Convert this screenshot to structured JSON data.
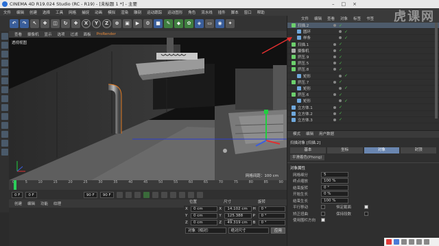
{
  "window": {
    "title": "CINEMA 4D R19.024 Studio (RC - R19) - [未标题 1 *] - 主要"
  },
  "watermark": "虎课网",
  "menubar": {
    "items": [
      "文件",
      "编辑",
      "创建",
      "选择",
      "工具",
      "网格",
      "捕捉",
      "动画",
      "模拟",
      "渲染",
      "雕刻",
      "运动跟踪",
      "运动图形",
      "角色",
      "流水线",
      "插件",
      "脚本",
      "窗口",
      "帮助"
    ]
  },
  "toolbar": {
    "axis_x": "X",
    "axis_y": "Y",
    "axis_z": "Z"
  },
  "viewport": {
    "menu": [
      "查看",
      "摄像机",
      "显示",
      "选项",
      "过滤",
      "面板"
    ],
    "prorender": "ProRender",
    "label": "透视视图",
    "grid_spacing": "网格间距：100 cm"
  },
  "timeline": {
    "ticks": [
      "0",
      "5",
      "10",
      "15",
      "20",
      "25",
      "30",
      "35",
      "40",
      "45",
      "50",
      "55",
      "60",
      "65",
      "70",
      "75",
      "80",
      "85",
      "90"
    ],
    "current_frame_label": "0 F"
  },
  "transport": {
    "start": "0 F",
    "current": "0 F",
    "end": "90 F",
    "end2": "90 F"
  },
  "material_manager": {
    "menu": [
      "创建",
      "编辑",
      "功能",
      "纹理"
    ]
  },
  "coord_manager": {
    "headers": [
      "位置",
      "尺寸",
      "旋转"
    ],
    "rows": [
      {
        "axis": "X",
        "pos": "0 cm",
        "size": "14.102 cm",
        "rot_axis": "H",
        "rot": "0 °"
      },
      {
        "axis": "Y",
        "pos": "0 cm",
        "size": "125.388 cm",
        "rot_axis": "P",
        "rot": "0 °"
      },
      {
        "axis": "Z",
        "pos": "0 cm",
        "size": "49.319 cm",
        "rot_axis": "B",
        "rot": "0 °"
      }
    ],
    "mode": "对象（相对）",
    "size_mode": "绝对尺寸",
    "apply": "应用"
  },
  "object_manager": {
    "menu": [
      "文件",
      "编辑",
      "查看",
      "对象",
      "标签",
      "书签"
    ],
    "items": [
      {
        "name": "扫描.2",
        "selected": true,
        "color": "#6ccf6c"
      },
      {
        "name": "圆环",
        "selected": false,
        "color": "#6fa8dc"
      },
      {
        "name": "样条",
        "selected": false,
        "color": "#6fa8dc"
      },
      {
        "name": "扫描.1",
        "selected": false,
        "color": "#6ccf6c"
      },
      {
        "name": "摄像机",
        "selected": false,
        "color": "#aaaaaa"
      },
      {
        "name": "挤压.9",
        "selected": false,
        "color": "#6ccf6c"
      },
      {
        "name": "挤压.5",
        "selected": false,
        "color": "#6ccf6c"
      },
      {
        "name": "挤压.8",
        "selected": false,
        "color": "#6ccf6c"
      },
      {
        "name": "矩形",
        "selected": false,
        "color": "#6fa8dc"
      },
      {
        "name": "挤压.7",
        "selected": false,
        "color": "#6ccf6c"
      },
      {
        "name": "矩形",
        "selected": false,
        "color": "#6fa8dc"
      },
      {
        "name": "挤压.6",
        "selected": false,
        "color": "#6ccf6c"
      },
      {
        "name": "矩形",
        "selected": false,
        "color": "#6fa8dc"
      },
      {
        "name": "立方体.1",
        "selected": false,
        "color": "#6fa8dc"
      },
      {
        "name": "立方体.2",
        "selected": false,
        "color": "#6fa8dc"
      },
      {
        "name": "立方体.3",
        "selected": false,
        "color": "#6fa8dc"
      }
    ]
  },
  "attribute_manager": {
    "menu": [
      "模式",
      "编辑",
      "用户数据"
    ],
    "title": "扫描对象 [扫描.2]",
    "tabs": [
      "基本",
      "坐标",
      "对象",
      "封顶"
    ],
    "active_tab": "对象",
    "phong": "平滑着色(Phong)",
    "section": "对象属性",
    "rows": [
      {
        "label": "网格细分",
        "value": "5"
      },
      {
        "label": "终点缩放",
        "value": "100 %"
      },
      {
        "label": "结束旋转",
        "value": "0 °"
      },
      {
        "label": "开始生长",
        "value": "0 %"
      },
      {
        "label": "结束生长",
        "value": "100 %"
      }
    ],
    "checks": [
      {
        "label": "平行移动",
        "on": false,
        "label2": "恒定截面",
        "on2": true
      },
      {
        "label": "矫正扭曲",
        "on": false,
        "label2": "保持段数",
        "on2": false
      },
      {
        "label": "使用围栏方向",
        "on": true
      }
    ]
  },
  "colors": {
    "accent_selected": "#6a86b0",
    "object_green": "#4fc24f",
    "playhead": "#2bd05a",
    "arrow_red": "#e53030"
  }
}
